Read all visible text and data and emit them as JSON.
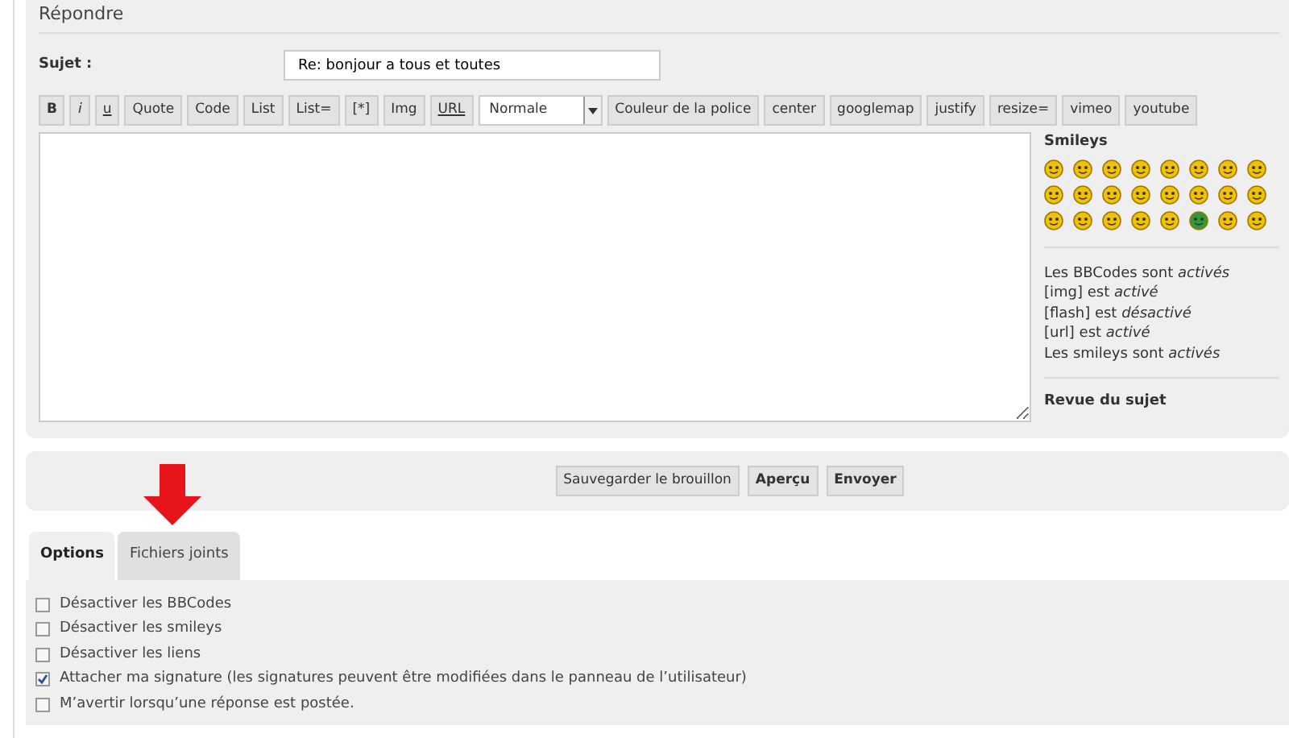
{
  "heading": "Répondre",
  "subject": {
    "label": "Sujet :",
    "value": "Re: bonjour a tous et toutes"
  },
  "toolbar": [
    {
      "kind": "button",
      "label": "B"
    },
    {
      "kind": "button",
      "label": "i"
    },
    {
      "kind": "button",
      "label": "u"
    },
    {
      "kind": "button",
      "label": "Quote"
    },
    {
      "kind": "button",
      "label": "Code"
    },
    {
      "kind": "button",
      "label": "List"
    },
    {
      "kind": "button",
      "label": "List="
    },
    {
      "kind": "button",
      "label": "[*]"
    },
    {
      "kind": "button",
      "label": "Img"
    },
    {
      "kind": "button",
      "label": "URL"
    },
    {
      "kind": "select",
      "label": "Normale"
    },
    {
      "kind": "button",
      "label": "Couleur de la police"
    },
    {
      "kind": "button",
      "label": "center"
    },
    {
      "kind": "button",
      "label": "googlemap"
    },
    {
      "kind": "button",
      "label": "justify"
    },
    {
      "kind": "button",
      "label": "resize="
    },
    {
      "kind": "button",
      "label": "vimeo"
    },
    {
      "kind": "button",
      "label": "youtube"
    }
  ],
  "sidebar": {
    "smileys_title": "Smileys",
    "smileys": [
      {
        "color": "#f2c200"
      },
      {
        "color": "#f2c200"
      },
      {
        "color": "#f2c200"
      },
      {
        "color": "#f2c200"
      },
      {
        "color": "#f2c200"
      },
      {
        "color": "#f2c200"
      },
      {
        "color": "#f2c200"
      },
      {
        "color": "#f2c200"
      },
      {
        "color": "#f2c200"
      },
      {
        "color": "#f2c200"
      },
      {
        "color": "#f2c200"
      },
      {
        "color": "#f2c200"
      },
      {
        "color": "#f2c200"
      },
      {
        "color": "#f2c200"
      },
      {
        "color": "#f2c200"
      },
      {
        "color": "#f2c200"
      },
      {
        "color": "#f2c200"
      },
      {
        "color": "#f2c200"
      },
      {
        "color": "#f2c200"
      },
      {
        "color": "#f2c200"
      },
      {
        "color": "#f2c200"
      },
      {
        "color": "#2e9a3c"
      },
      {
        "color": "#f2c200"
      },
      {
        "color": "#f2c200"
      }
    ],
    "status": [
      "Les BBCodes sont *activés*",
      "[img] est *activé*",
      "[flash] est *désactivé*",
      "[url] est *activé*",
      "Les smileys sont *activés*"
    ],
    "review_title": "Revue du sujet"
  },
  "actions": [
    {
      "label": "Sauvegarder le brouillon"
    },
    {
      "label": "Aperçu"
    },
    {
      "label": "Envoyer"
    }
  ],
  "tabs": [
    {
      "label": "Options",
      "selected": true
    },
    {
      "label": "Fichiers joints",
      "selected": false
    }
  ],
  "options": [
    {
      "label": "Désactiver les BBCodes",
      "checked": false
    },
    {
      "label": "Désactiver les smileys",
      "checked": false
    },
    {
      "label": "Désactiver les liens",
      "checked": false
    },
    {
      "label": "Attacher ma signature (les signatures peuvent être modifiées dans le panneau de l’utilisateur)",
      "checked": true
    },
    {
      "label": "M’avertir lorsqu’une réponse est postée.",
      "checked": false
    }
  ]
}
